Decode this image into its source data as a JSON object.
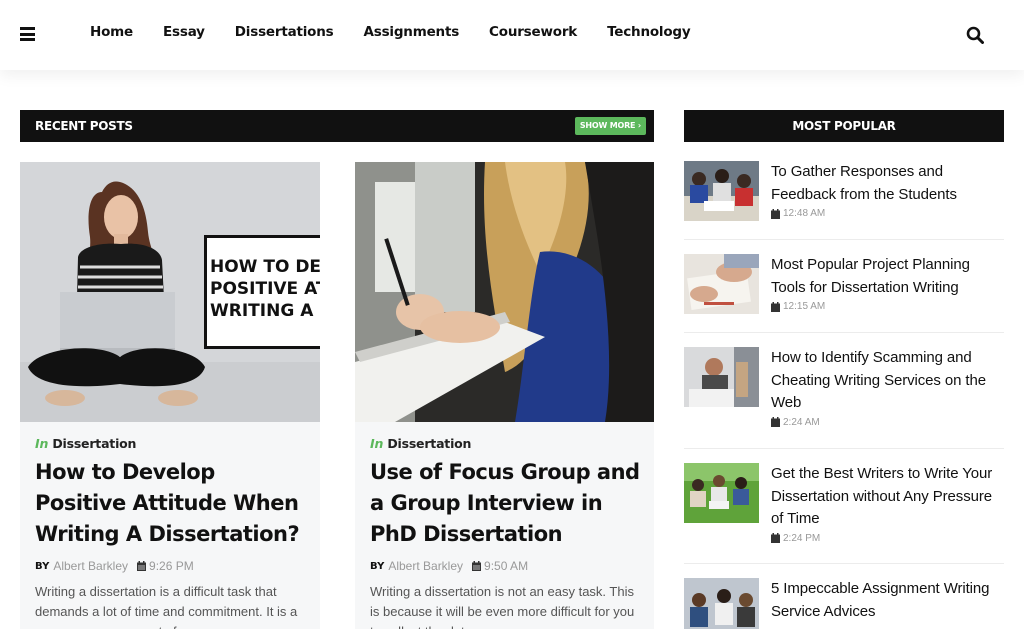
{
  "nav": {
    "items": [
      "Home",
      "Essay",
      "Dissertations",
      "Assignments",
      "Coursework",
      "Technology"
    ]
  },
  "recent": {
    "title": "RECENT POSTS",
    "show_more": "SHOW MORE ›",
    "posts": [
      {
        "category_prefix": "In",
        "category": "Dissertation",
        "title": "How to Develop Positive Attitude When Writing A Dissertation?",
        "by": "BY",
        "author": "Albert Barkley",
        "time": "9:26 PM",
        "excerpt": "Writing a dissertation is a difficult task that demands a lot of time and commitment. It is a necessary component of a",
        "image_text": [
          "HOW TO DEV",
          "POSITIVE AT",
          "WRITING A I"
        ]
      },
      {
        "category_prefix": "In",
        "category": "Dissertation",
        "title": "Use of Focus Group and a Group Interview in PhD Dissertation",
        "by": "BY",
        "author": "Albert Barkley",
        "time": "9:50 AM",
        "excerpt": "Writing a dissertation is not an easy task. This is because it will be even more difficult for you to collect the data"
      }
    ]
  },
  "popular": {
    "title": "MOST POPULAR",
    "items": [
      {
        "title": "To Gather Responses and Feedback from the Students",
        "time": "12:48 AM"
      },
      {
        "title": "Most Popular Project Planning Tools for Dissertation Writing",
        "time": "12:15 AM"
      },
      {
        "title": "How to Identify Scamming and Cheating Writing Services on the Web",
        "time": "2:24 AM"
      },
      {
        "title": "Get the Best Writers to Write Your Dissertation without Any Pressure of Time",
        "time": "2:24 PM"
      },
      {
        "title": "5 Impeccable Assignment Writing Service Advices",
        "time": ""
      }
    ]
  },
  "colors": {
    "accent_green": "#5cb85c",
    "bar_black": "#111111",
    "card_bg": "#f6f7f8"
  },
  "icons": [
    "menu-icon",
    "search-icon",
    "calendar-icon"
  ]
}
